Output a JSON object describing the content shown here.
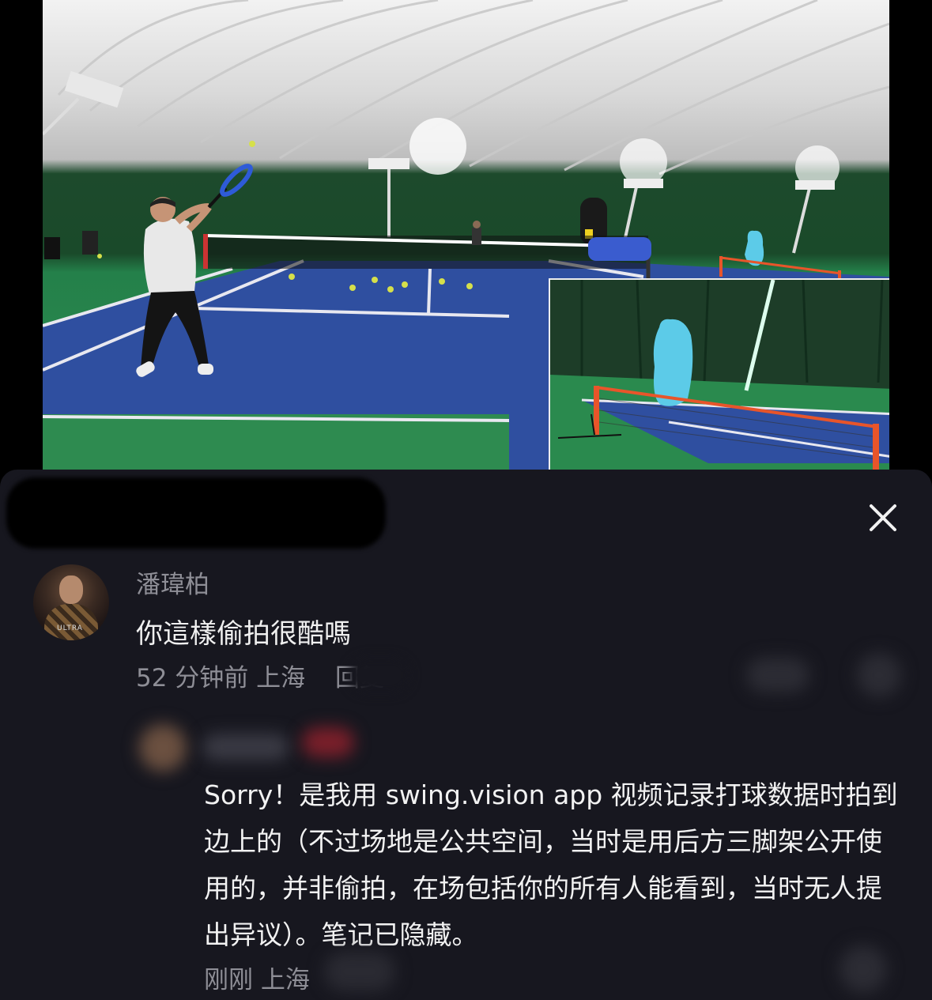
{
  "comment": {
    "username": "潘瑋柏",
    "avatar_caption": "ULTRA",
    "text": "你這樣偷拍很酷嗎",
    "time": "52 分钟前",
    "location": "上海",
    "reply_label": "回复"
  },
  "reply": {
    "text": "Sorry！是我用 swing.vision app 视频记录打球数据时拍到边上的（不过场地是公共空间，当时是用后方三脚架公开使用的，并非偷拍，在场包括你的所有人能看到，当时无人提出异议）。笔记已隐藏。",
    "time": "刚刚",
    "location": "上海"
  },
  "icons": {
    "close": "close-icon",
    "like": "heart-icon",
    "dislike": "dislike-icon"
  },
  "colors": {
    "sheet_bg": "#17171f",
    "secondary_text": "#8e8e96",
    "court_blue": "#2f4fa0",
    "net_orange": "#e8552a",
    "redaction_blue": "#5ccbe8"
  }
}
